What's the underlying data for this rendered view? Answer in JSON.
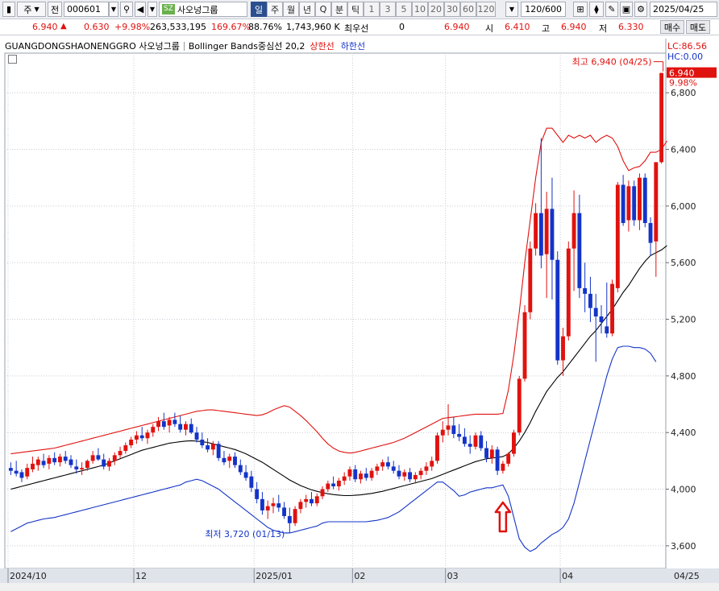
{
  "toolbar": {
    "market": "주",
    "type_label": "전",
    "code": "000601",
    "exchange_badge": "SZ",
    "stock_name": "사오넝그룹",
    "periods": [
      {
        "label": "일",
        "active": true
      },
      {
        "label": "주",
        "active": false
      },
      {
        "label": "월",
        "active": false
      },
      {
        "label": "년",
        "active": false
      },
      {
        "label": "Q",
        "active": false
      },
      {
        "label": "분",
        "active": false
      },
      {
        "label": "틱",
        "active": false
      }
    ],
    "minute_options": [
      "1",
      "3",
      "5",
      "10",
      "20",
      "30",
      "60",
      "120"
    ],
    "count": "120/600",
    "date": "2025/04/25"
  },
  "quote": {
    "price": "6.940",
    "change": "0.630",
    "change_pct": "+9.98%",
    "volume": "263,533,195",
    "volume_ratio": "169.67%",
    "turnover_ratio": "88.76%",
    "amount": "1,743,960 K",
    "best_ask_label": "최우선",
    "best_ask": "0",
    "best_bid": "6.940",
    "open_label": "시",
    "open": "6.410",
    "high_label": "고",
    "high": "6.940",
    "low_label": "저",
    "low": "6.330",
    "buy_label": "매수",
    "sell_label": "매도"
  },
  "legend": {
    "stock": "GUANGDONGSHAONENGGRO 사오넝그룹",
    "indicator": "Bollinger Bands중심선 20,2",
    "upper": "상한선",
    "lower": "하한선"
  },
  "colors": {
    "up": "#e0120f",
    "down": "#1434c8",
    "middle": "#000000",
    "upper": "#e0120f",
    "lower": "#1434c8",
    "arrow": "#e0120f"
  },
  "chart_data": {
    "type": "candlestick",
    "y_ticks": [
      3600,
      4000,
      4400,
      4800,
      5200,
      5600,
      6000,
      6400,
      6800
    ],
    "y_tick_labels": [
      "3,600",
      "4,000",
      "4,400",
      "4,800",
      "5,200",
      "5,600",
      "6,000",
      "6,400",
      "6,800"
    ],
    "ylim": [
      3440,
      7080
    ],
    "x_labels": [
      {
        "index": 0,
        "label": "2024/10"
      },
      {
        "index": 23,
        "label": "12"
      },
      {
        "index": 45,
        "label": "2025/01"
      },
      {
        "index": 63,
        "label": "02"
      },
      {
        "index": 80,
        "label": "03"
      },
      {
        "index": 101,
        "label": "04"
      },
      {
        "index": 120,
        "label": "04/25"
      }
    ],
    "lc_label": "LC:86.56",
    "hc_label": "HC:0.00",
    "last_price_label": "6.940",
    "last_pct_label": "9.98%",
    "max_annotation": "최고 6,940 (04/25)",
    "min_annotation": "최저 3,720 (01/13)",
    "max_index": 119,
    "max_value": 6940,
    "min_index": 51,
    "min_value": 3720,
    "arrow_index": 90,
    "candles": [
      [
        4150,
        4190,
        4100,
        4130
      ],
      [
        4130,
        4200,
        4090,
        4110
      ],
      [
        4120,
        4140,
        4050,
        4080
      ],
      [
        4090,
        4180,
        4070,
        4150
      ],
      [
        4140,
        4230,
        4120,
        4180
      ],
      [
        4170,
        4230,
        4130,
        4210
      ],
      [
        4200,
        4250,
        4150,
        4170
      ],
      [
        4180,
        4240,
        4140,
        4220
      ],
      [
        4220,
        4260,
        4170,
        4190
      ],
      [
        4190,
        4250,
        4160,
        4230
      ],
      [
        4230,
        4270,
        4180,
        4200
      ],
      [
        4210,
        4240,
        4150,
        4170
      ],
      [
        4160,
        4210,
        4110,
        4140
      ],
      [
        4140,
        4190,
        4100,
        4150
      ],
      [
        4150,
        4210,
        4130,
        4200
      ],
      [
        4200,
        4270,
        4180,
        4240
      ],
      [
        4240,
        4290,
        4200,
        4210
      ],
      [
        4210,
        4250,
        4140,
        4160
      ],
      [
        4160,
        4220,
        4130,
        4200
      ],
      [
        4200,
        4260,
        4170,
        4240
      ],
      [
        4240,
        4300,
        4220,
        4270
      ],
      [
        4270,
        4330,
        4250,
        4310
      ],
      [
        4310,
        4370,
        4290,
        4350
      ],
      [
        4350,
        4410,
        4320,
        4380
      ],
      [
        4380,
        4440,
        4340,
        4360
      ],
      [
        4360,
        4420,
        4320,
        4400
      ],
      [
        4400,
        4460,
        4370,
        4440
      ],
      [
        4440,
        4510,
        4410,
        4480
      ],
      [
        4480,
        4540,
        4420,
        4440
      ],
      [
        4450,
        4510,
        4400,
        4490
      ],
      [
        4490,
        4540,
        4440,
        4460
      ],
      [
        4460,
        4520,
        4400,
        4420
      ],
      [
        4420,
        4480,
        4380,
        4460
      ],
      [
        4460,
        4500,
        4390,
        4400
      ],
      [
        4400,
        4440,
        4330,
        4350
      ],
      [
        4350,
        4400,
        4290,
        4310
      ],
      [
        4310,
        4360,
        4260,
        4280
      ],
      [
        4280,
        4340,
        4240,
        4320
      ],
      [
        4320,
        4340,
        4200,
        4220
      ],
      [
        4220,
        4270,
        4170,
        4190
      ],
      [
        4200,
        4250,
        4150,
        4230
      ],
      [
        4230,
        4260,
        4150,
        4170
      ],
      [
        4170,
        4210,
        4100,
        4120
      ],
      [
        4120,
        4170,
        4060,
        4080
      ],
      [
        4090,
        4130,
        3980,
        4010
      ],
      [
        4000,
        4050,
        3900,
        3930
      ],
      [
        3930,
        3980,
        3820,
        3850
      ],
      [
        3850,
        3920,
        3790,
        3880
      ],
      [
        3880,
        3940,
        3830,
        3900
      ],
      [
        3900,
        3960,
        3840,
        3870
      ],
      [
        3870,
        3910,
        3790,
        3810
      ],
      [
        3810,
        3870,
        3720,
        3760
      ],
      [
        3760,
        3880,
        3740,
        3860
      ],
      [
        3860,
        3930,
        3830,
        3910
      ],
      [
        3910,
        3960,
        3870,
        3930
      ],
      [
        3930,
        3980,
        3880,
        3900
      ],
      [
        3900,
        3970,
        3880,
        3950
      ],
      [
        3950,
        4020,
        3930,
        4000
      ],
      [
        4000,
        4060,
        3980,
        4040
      ],
      [
        4040,
        4090,
        4000,
        4020
      ],
      [
        4020,
        4080,
        3990,
        4060
      ],
      [
        4060,
        4120,
        4030,
        4090
      ],
      [
        4090,
        4160,
        4060,
        4140
      ],
      [
        4140,
        4170,
        4050,
        4070
      ],
      [
        4070,
        4130,
        4040,
        4110
      ],
      [
        4110,
        4150,
        4060,
        4080
      ],
      [
        4080,
        4150,
        4060,
        4130
      ],
      [
        4130,
        4180,
        4100,
        4160
      ],
      [
        4160,
        4210,
        4130,
        4190
      ],
      [
        4190,
        4230,
        4140,
        4160
      ],
      [
        4160,
        4200,
        4110,
        4130
      ],
      [
        4130,
        4170,
        4070,
        4090
      ],
      [
        4090,
        4140,
        4060,
        4120
      ],
      [
        4120,
        4150,
        4050,
        4070
      ],
      [
        4070,
        4120,
        4040,
        4100
      ],
      [
        4100,
        4150,
        4070,
        4130
      ],
      [
        4130,
        4190,
        4100,
        4160
      ],
      [
        4160,
        4230,
        4130,
        4200
      ],
      [
        4200,
        4400,
        4180,
        4380
      ],
      [
        4380,
        4480,
        4330,
        4420
      ],
      [
        4420,
        4600,
        4380,
        4450
      ],
      [
        4450,
        4510,
        4360,
        4390
      ],
      [
        4390,
        4460,
        4340,
        4370
      ],
      [
        4370,
        4430,
        4300,
        4320
      ],
      [
        4320,
        4380,
        4250,
        4300
      ],
      [
        4300,
        4400,
        4280,
        4380
      ],
      [
        4380,
        4410,
        4270,
        4290
      ],
      [
        4290,
        4340,
        4190,
        4220
      ],
      [
        4220,
        4310,
        4180,
        4280
      ],
      [
        4280,
        4300,
        4100,
        4130
      ],
      [
        4130,
        4200,
        4110,
        4180
      ],
      [
        4180,
        4260,
        4160,
        4250
      ],
      [
        4250,
        4420,
        4230,
        4400
      ],
      [
        4400,
        4800,
        4380,
        4780
      ],
      [
        4780,
        5300,
        4760,
        5250
      ],
      [
        5250,
        5750,
        5200,
        5700
      ],
      [
        5700,
        6020,
        5650,
        5950
      ],
      [
        5950,
        6480,
        5560,
        5650
      ],
      [
        5660,
        6100,
        5350,
        5980
      ],
      [
        5980,
        6200,
        5340,
        5620
      ],
      [
        5620,
        5680,
        4880,
        4910
      ],
      [
        4910,
        5140,
        4800,
        5080
      ],
      [
        5080,
        5750,
        5050,
        5700
      ],
      [
        5700,
        6110,
        5400,
        5950
      ],
      [
        5950,
        6080,
        5350,
        5420
      ],
      [
        5420,
        5600,
        5250,
        5380
      ],
      [
        5380,
        5500,
        5180,
        5280
      ],
      [
        5280,
        5380,
        4900,
        5220
      ],
      [
        5220,
        5300,
        5100,
        5180
      ],
      [
        5150,
        5460,
        5070,
        5100
      ],
      [
        5100,
        5480,
        5080,
        5450
      ],
      [
        5420,
        6170,
        5390,
        6150
      ],
      [
        6150,
        6220,
        5860,
        5880
      ],
      [
        5900,
        6180,
        5820,
        6140
      ],
      [
        6140,
        6180,
        5860,
        5900
      ],
      [
        5900,
        6230,
        5830,
        6200
      ],
      [
        6200,
        6230,
        5850,
        5880
      ],
      [
        5880,
        5920,
        5650,
        5740
      ],
      [
        5750,
        6290,
        5500,
        6310
      ],
      [
        6310,
        6940,
        6300,
        6940
      ]
    ],
    "middle": [
      4000,
      4010,
      4020,
      4030,
      4040,
      4050,
      4060,
      4070,
      4080,
      4090,
      4100,
      4110,
      4120,
      4130,
      4140,
      4150,
      4160,
      4170,
      4185,
      4200,
      4215,
      4230,
      4245,
      4260,
      4275,
      4285,
      4295,
      4305,
      4315,
      4325,
      4330,
      4335,
      4340,
      4342,
      4340,
      4335,
      4330,
      4320,
      4310,
      4300,
      4290,
      4280,
      4265,
      4250,
      4230,
      4210,
      4190,
      4165,
      4140,
      4115,
      4090,
      4065,
      4045,
      4025,
      4010,
      3995,
      3985,
      3975,
      3968,
      3962,
      3958,
      3955,
      3955,
      3957,
      3960,
      3965,
      3970,
      3978,
      3985,
      3995,
      4005,
      4015,
      4025,
      4035,
      4045,
      4055,
      4065,
      4075,
      4090,
      4105,
      4120,
      4135,
      4150,
      4165,
      4180,
      4195,
      4205,
      4215,
      4220,
      4225,
      4230,
      4250,
      4290,
      4340,
      4400,
      4470,
      4550,
      4620,
      4690,
      4740,
      4790,
      4830,
      4880,
      4930,
      4980,
      5030,
      5080,
      5120,
      5170,
      5220,
      5270,
      5330,
      5390,
      5440,
      5500,
      5560,
      5610,
      5650,
      5670,
      5690,
      5720
    ],
    "upper": [
      4250,
      4255,
      4260,
      4265,
      4270,
      4275,
      4280,
      4285,
      4290,
      4300,
      4310,
      4320,
      4330,
      4340,
      4350,
      4360,
      4370,
      4380,
      4390,
      4400,
      4410,
      4420,
      4430,
      4440,
      4450,
      4460,
      4470,
      4480,
      4490,
      4500,
      4510,
      4520,
      4530,
      4540,
      4550,
      4555,
      4560,
      4560,
      4555,
      4550,
      4545,
      4540,
      4535,
      4530,
      4525,
      4520,
      4525,
      4540,
      4560,
      4575,
      4590,
      4580,
      4550,
      4520,
      4485,
      4445,
      4405,
      4360,
      4320,
      4290,
      4270,
      4260,
      4255,
      4260,
      4270,
      4280,
      4290,
      4300,
      4310,
      4320,
      4330,
      4345,
      4360,
      4380,
      4400,
      4420,
      4440,
      4460,
      4480,
      4500,
      4505,
      4510,
      4515,
      4520,
      4525,
      4530,
      4530,
      4530,
      4530,
      4530,
      4535,
      4700,
      4950,
      5250,
      5600,
      5900,
      6200,
      6450,
      6550,
      6550,
      6500,
      6450,
      6500,
      6480,
      6500,
      6480,
      6500,
      6450,
      6480,
      6500,
      6480,
      6420,
      6320,
      6250,
      6270,
      6280,
      6320,
      6380,
      6380,
      6400,
      6460
    ],
    "lower": [
      3700,
      3720,
      3740,
      3760,
      3770,
      3780,
      3790,
      3795,
      3800,
      3810,
      3820,
      3830,
      3840,
      3850,
      3860,
      3870,
      3880,
      3890,
      3900,
      3910,
      3920,
      3930,
      3940,
      3950,
      3960,
      3970,
      3980,
      3990,
      4000,
      4010,
      4020,
      4030,
      4050,
      4060,
      4070,
      4060,
      4040,
      4020,
      4000,
      3970,
      3940,
      3910,
      3880,
      3850,
      3820,
      3790,
      3760,
      3730,
      3710,
      3700,
      3690,
      3690,
      3700,
      3710,
      3720,
      3730,
      3740,
      3760,
      3770,
      3770,
      3770,
      3770,
      3770,
      3770,
      3770,
      3770,
      3775,
      3780,
      3790,
      3800,
      3820,
      3840,
      3870,
      3900,
      3930,
      3960,
      3990,
      4020,
      4050,
      4050,
      4020,
      3990,
      3950,
      3960,
      3980,
      3990,
      4000,
      4010,
      4010,
      4020,
      4030,
      3950,
      3800,
      3650,
      3590,
      3560,
      3580,
      3620,
      3650,
      3680,
      3700,
      3730,
      3790,
      3900,
      4050,
      4200,
      4350,
      4500,
      4650,
      4800,
      4920,
      5000,
      5010,
      5010,
      5000,
      5000,
      4990,
      4960,
      4900
    ]
  }
}
